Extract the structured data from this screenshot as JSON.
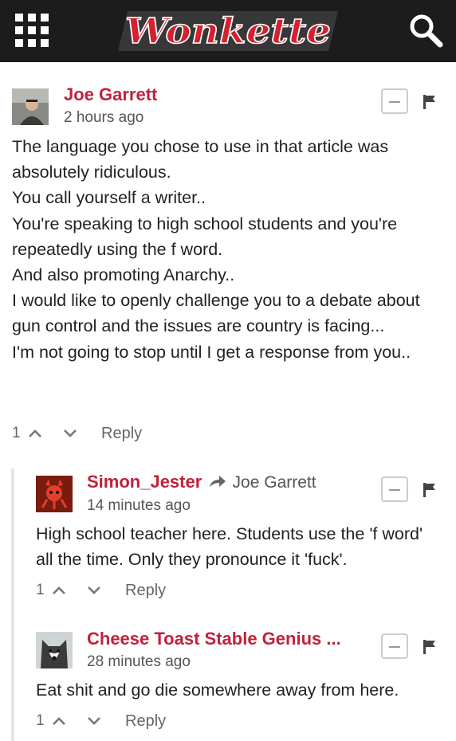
{
  "site": {
    "logo_text": "Wonkette"
  },
  "comments": [
    {
      "author": "Joe Garrett",
      "time": "2 hours ago",
      "lines": [
        "The language you chose to use in that article was absolutely ridiculous.",
        "You call yourself a writer..",
        "You're speaking to high school students and you're repeatedly using the f word.",
        "And also promoting Anarchy..",
        "I would like to openly challenge you to a debate about gun control and the issues are country is facing...",
        "I'm not going to stop until I get a response from you.."
      ],
      "votes": "1",
      "reply_label": "Reply"
    },
    {
      "author": "Simon_Jester",
      "reply_to": "Joe Garrett",
      "time": "14 minutes ago",
      "lines": [
        "High school teacher here. Students use the 'f word' all the time. Only they pronounce it 'fuck'."
      ],
      "votes": "1",
      "reply_label": "Reply"
    },
    {
      "author": "Cheese Toast Stable Genius ...",
      "time": "28 minutes ago",
      "lines": [
        "Eat shit and go die somewhere away from here."
      ],
      "votes": "1",
      "reply_label": "Reply"
    }
  ],
  "colors": {
    "header": "#1c1c1c",
    "author": "#c0223b",
    "logo": "#d6202f"
  }
}
